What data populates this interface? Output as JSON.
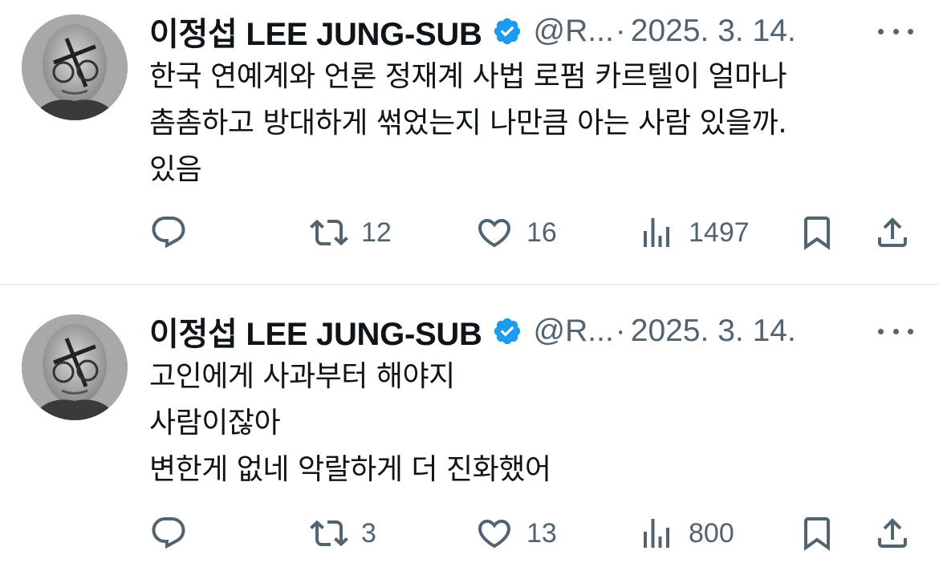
{
  "tweets": [
    {
      "name": "이정섭 LEE JUNG-SUB",
      "handle": "@R...",
      "separator": "·",
      "date": "2025. 3. 14.",
      "lines": [
        "한국 연예계와 언론 정재계 사법 로펌 카르텔이 얼마나",
        "촘촘하고 방대하게 썪었는지 나만큼 아는 사람 있을까.",
        "있음"
      ],
      "replies": "",
      "retweets": "12",
      "likes": "16",
      "views": "1497"
    },
    {
      "name": "이정섭 LEE JUNG-SUB",
      "handle": "@R...",
      "separator": "·",
      "date": "2025. 3. 14.",
      "lines": [
        "고인에게 사과부터 해야지",
        "사람이잖아",
        "변한게 없네 악랄하게 더 진화했어"
      ],
      "replies": "",
      "retweets": "3",
      "likes": "13",
      "views": "800"
    }
  ],
  "icons": {
    "verified": "verified-badge-icon",
    "more": "more-options-icon",
    "reply": "reply-icon",
    "retweet": "retweet-icon",
    "like": "heart-icon",
    "views": "views-chart-icon",
    "bookmark": "bookmark-icon",
    "share": "share-icon"
  },
  "colors": {
    "text": "#0f1419",
    "secondary": "#536471",
    "verified": "#1d9bf0",
    "divider": "#e6e9ec"
  }
}
